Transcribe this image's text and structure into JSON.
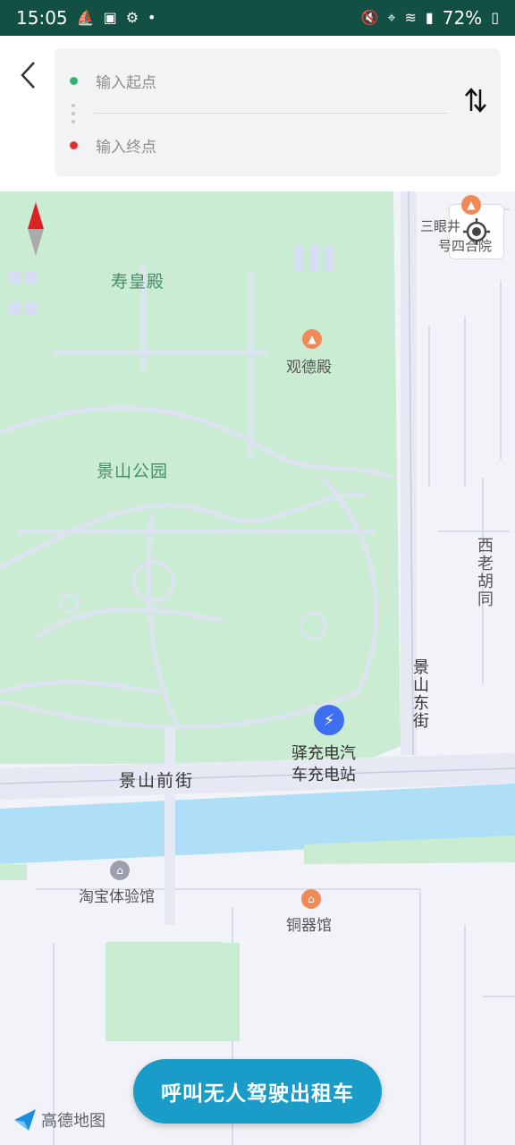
{
  "status_bar": {
    "time": "15:05",
    "battery": "72%"
  },
  "route_panel": {
    "start_placeholder": "输入起点",
    "end_placeholder": "输入终点"
  },
  "map": {
    "labels": {
      "shouhuangdian": "寿皇殿",
      "guandedian": "观德殿",
      "jingshan_park": "景山公园",
      "courtyard_1": "三眼井",
      "courtyard_2": "号四合院",
      "xilao_hutong": "西老胡同",
      "jingshan_dongjie": "景山东街",
      "charging_station_1": "驿充电汽",
      "charging_station_2": "车充电站",
      "jingshan_qianjie": "景山前街",
      "taobao_store": "淘宝体验馆",
      "bronze_museum": "铜器馆"
    }
  },
  "actions": {
    "call_taxi": "呼叫无人驾驶出租车"
  },
  "branding": {
    "logo_text": "高德地图"
  }
}
